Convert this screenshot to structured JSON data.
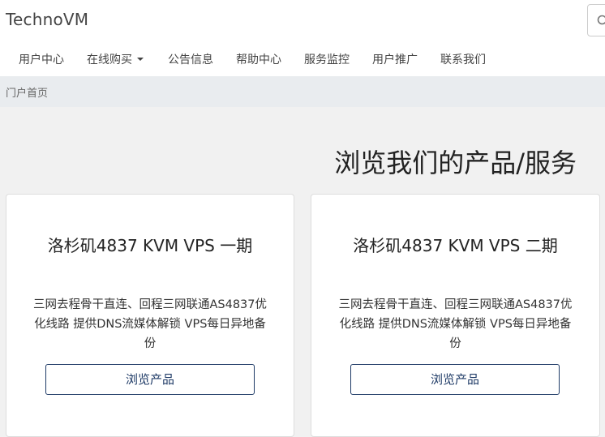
{
  "brand": "TechnoVM",
  "nav": {
    "items": [
      {
        "label": "用户中心"
      },
      {
        "label": "在线购买"
      },
      {
        "label": "公告信息"
      },
      {
        "label": "帮助中心"
      },
      {
        "label": "服务监控"
      },
      {
        "label": "用户推广"
      },
      {
        "label": "联系我们"
      }
    ]
  },
  "breadcrumb": "门户首页",
  "page_title": "浏览我们的产品/服务",
  "products": [
    {
      "title": "洛杉矶4837 KVM VPS 一期",
      "description": "三网去程骨干直连、回程三网联通AS4837优化线路 提供DNS流媒体解锁 VPS每日异地备份",
      "button": "浏览产品"
    },
    {
      "title": "洛杉矶4837 KVM VPS 二期",
      "description": "三网去程骨干直连、回程三网联通AS4837优化线路 提供DNS流媒体解锁 VPS每日异地备份",
      "button": "浏览产品"
    }
  ],
  "icons": {
    "search": "search-icon",
    "dropdown": "chevron-down-icon"
  }
}
